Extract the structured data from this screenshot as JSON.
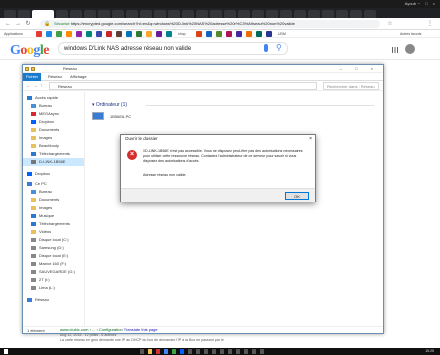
{
  "os_bar": {
    "user": "Ayoub",
    "controls": "− □ ×"
  },
  "chrome": {
    "url_secure": "Sécurisé",
    "url": "https://encrypted.google.com/search?hl=en&q=windows%20D-link%20NAS%20adresse%20r%C3%A9seau%20non%20valide",
    "bookmarks": [
      "Applications",
      "shop",
      "UDM",
      "Autres favoris"
    ]
  },
  "google": {
    "logo": "Google",
    "query": "windows D'Link NAS adresse réseau non valide"
  },
  "explorer": {
    "title": "Réseau",
    "ribbon_tabs": [
      "Fichier",
      "Réseau",
      "Affichage"
    ],
    "address": "Réseau",
    "search_placeholder": "Rechercher dans : Réseau",
    "nav_items": [
      "Accès rapide",
      "Bureau",
      "MEGAsync",
      "Dropbox",
      "Documents",
      "Images",
      "Beachbody",
      "Téléchargements",
      "D-LINK-1B56E",
      "Dropbox",
      "Ce PC",
      "Bureau",
      "Documents",
      "Images",
      "Musique",
      "Téléchargements",
      "Vidéos",
      "Disque local (C:)",
      "Samsung (D:)",
      "Disque local (E:)",
      "Maxtor 160 (F:)",
      "SAUVEGARDE (G:)",
      "2T (I:)",
      "Lima (L:)",
      "Réseau"
    ],
    "group_header": "Ordinateur (1)",
    "pc_label": "1B56E6-PC",
    "status": "1 élément"
  },
  "dialog": {
    "title": "Ouvrir le dossier",
    "message": "\\\\D-LINK-1B56E n'est pas accessible. Vous ne disposez peut-être pas des autorisations nécessaires pour utiliser cette ressource réseau. Contactez l'administrateur de ce serveur pour savoir si vous disposez des autorisations d'accès.",
    "detail": "Adresse réseau non valide.",
    "ok": "OK"
  },
  "result": {
    "url": "www.clubic.com › ... › Configuration",
    "title_link": "Translate this page",
    "meta": "Aug 12, 2015 - 12 posts - 6 authors",
    "snippet": "La carte réseau en gros demande une IP au DHCP du box de demander l'IP à la Box en passant par le"
  },
  "taskbar": {
    "time": "15:25"
  }
}
